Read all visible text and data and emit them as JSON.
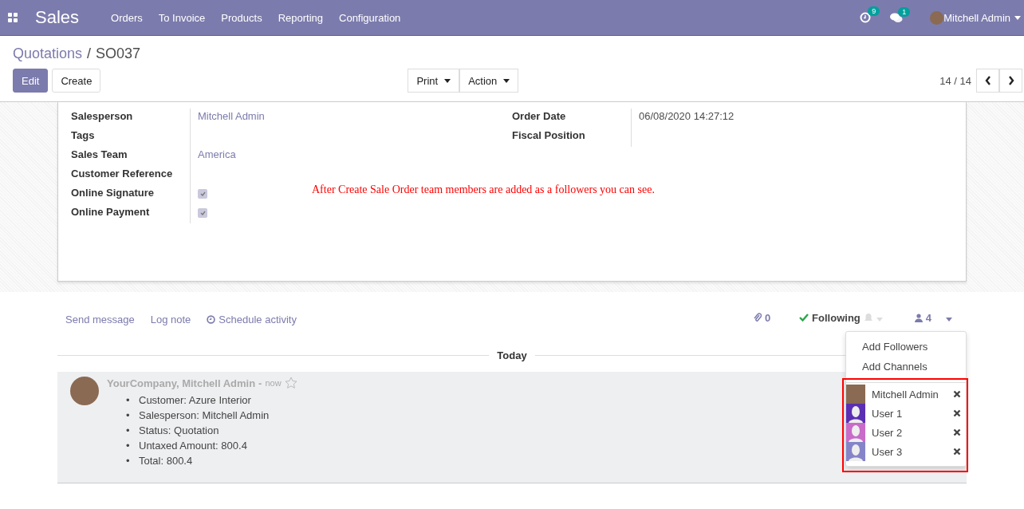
{
  "navbar": {
    "app": "Sales",
    "menu": [
      "Orders",
      "To Invoice",
      "Products",
      "Reporting",
      "Configuration"
    ],
    "activity_count": "9",
    "message_count": "1",
    "user": "Mitchell Admin"
  },
  "breadcrumb": {
    "parent": "Quotations",
    "separator": "/",
    "current": "SO037"
  },
  "buttons": {
    "primary": "Edit",
    "secondary": "Create",
    "dropdowns": [
      "Print",
      "Action"
    ]
  },
  "pager": {
    "value": "14 / 14"
  },
  "form": {
    "left": [
      {
        "label": "Salesperson",
        "kind": "link",
        "value": "Mitchell Admin"
      },
      {
        "label": "Tags",
        "kind": "text"
      },
      {
        "label": "Sales Team",
        "kind": "link",
        "value": "America"
      },
      {
        "label": "Customer Reference",
        "kind": "text"
      },
      {
        "label": "Online Signature",
        "kind": "checkbox",
        "checked": true
      },
      {
        "label": "Online Payment",
        "kind": "checkbox",
        "checked": true
      }
    ],
    "right": [
      {
        "label": "Order Date",
        "kind": "text",
        "value": "06/08/2020 14:27:12"
      },
      {
        "label": "Fiscal Position",
        "kind": "text"
      }
    ],
    "annotation": "After Create Sale Order team members are added as a followers you can see."
  },
  "chatter": {
    "actions": [
      "Send message",
      "Log note",
      "Schedule activity"
    ],
    "attachments": "0",
    "following": "Following",
    "followers_count": "4",
    "menu": [
      "Add Followers",
      "Add Channels"
    ],
    "followers": [
      {
        "name": "Mitchell Admin",
        "kind": "photo"
      },
      {
        "name": "User 1",
        "kind": "silhouette",
        "color": "#5b2fb3"
      },
      {
        "name": "User 2",
        "kind": "silhouette",
        "color": "#c86bc9"
      },
      {
        "name": "User 3",
        "kind": "silhouette",
        "color": "#8584c9"
      }
    ],
    "separator": "Today",
    "messages": [
      {
        "author": "YourCompany, Mitchell Admin",
        "dash": "-",
        "time": "now",
        "starred": false,
        "bullet": "•",
        "items": [
          "Customer: Azure Interior",
          "Salesperson: Mitchell Admin",
          "Status: Quotation",
          "Untaxed Amount: 800.4",
          "Total: 800.4"
        ]
      }
    ]
  }
}
